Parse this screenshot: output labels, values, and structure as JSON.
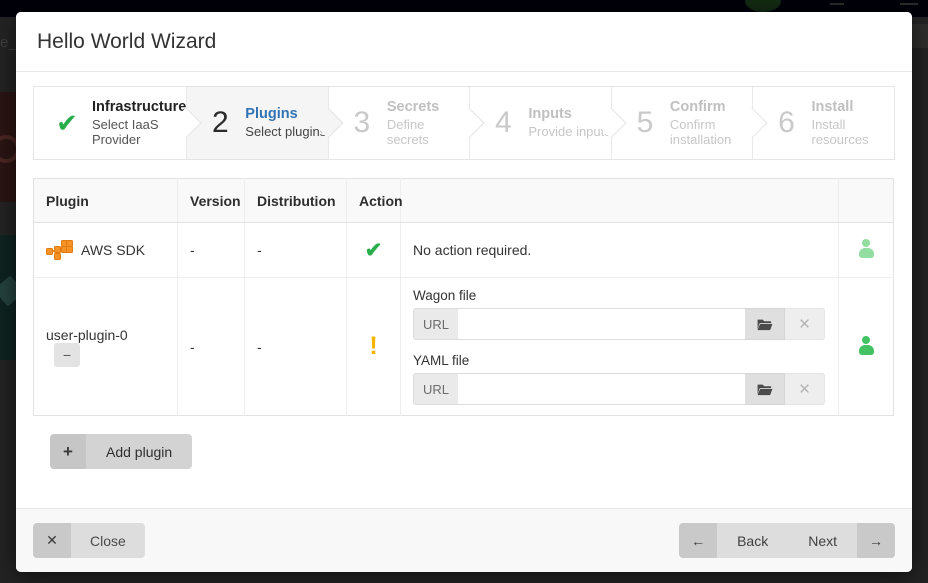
{
  "backdrop": {
    "ghost_text": "e_"
  },
  "modal": {
    "title": "Hello World Wizard"
  },
  "steps": [
    {
      "num": "✔",
      "name": "Infrastructure",
      "desc": "Select IaaS Provider",
      "state": "done"
    },
    {
      "num": "2",
      "name": "Plugins",
      "desc": "Select plugins",
      "state": "active"
    },
    {
      "num": "3",
      "name": "Secrets",
      "desc": "Define secrets",
      "state": "pending"
    },
    {
      "num": "4",
      "name": "Inputs",
      "desc": "Provide inputs",
      "state": "pending"
    },
    {
      "num": "5",
      "name": "Confirm",
      "desc": "Confirm installation",
      "state": "pending"
    },
    {
      "num": "6",
      "name": "Install",
      "desc": "Install resources",
      "state": "pending"
    }
  ],
  "table": {
    "headers": {
      "plugin": "Plugin",
      "version": "Version",
      "distribution": "Distribution",
      "action": "Action",
      "detail": "",
      "user": ""
    },
    "rows": [
      {
        "plugin_name": "AWS SDK",
        "version": "-",
        "distribution": "-",
        "action_icon": "check-icon",
        "action_text": "No action required.",
        "user_icon": "person-icon"
      },
      {
        "plugin_name": "user-plugin-0",
        "remove_label": "−",
        "version": "-",
        "distribution": "-",
        "action_icon": "warning-icon",
        "files": [
          {
            "label": "Wagon file",
            "addon": "URL",
            "value": "",
            "placeholder": "",
            "browse_icon": "folder-open-icon",
            "clear_icon": "close-icon"
          },
          {
            "label": "YAML file",
            "addon": "URL",
            "value": "",
            "placeholder": "",
            "browse_icon": "folder-open-icon",
            "clear_icon": "close-icon"
          }
        ],
        "user_icon": "person-icon"
      }
    ]
  },
  "add_plugin": {
    "icon": "plus-icon",
    "label": "Add plugin"
  },
  "footer": {
    "close": {
      "icon": "close-icon",
      "label": "Close"
    },
    "back": {
      "icon": "arrow-left-icon",
      "label": "Back"
    },
    "next": {
      "icon": "arrow-right-icon",
      "label": "Next"
    }
  },
  "colors": {
    "accent_blue": "#3273b4",
    "success_green": "#27ae4a",
    "warning_amber": "#f7b500",
    "aws_orange": "#f79326",
    "person_light": "#92dda0",
    "person_dark": "#42c263"
  }
}
